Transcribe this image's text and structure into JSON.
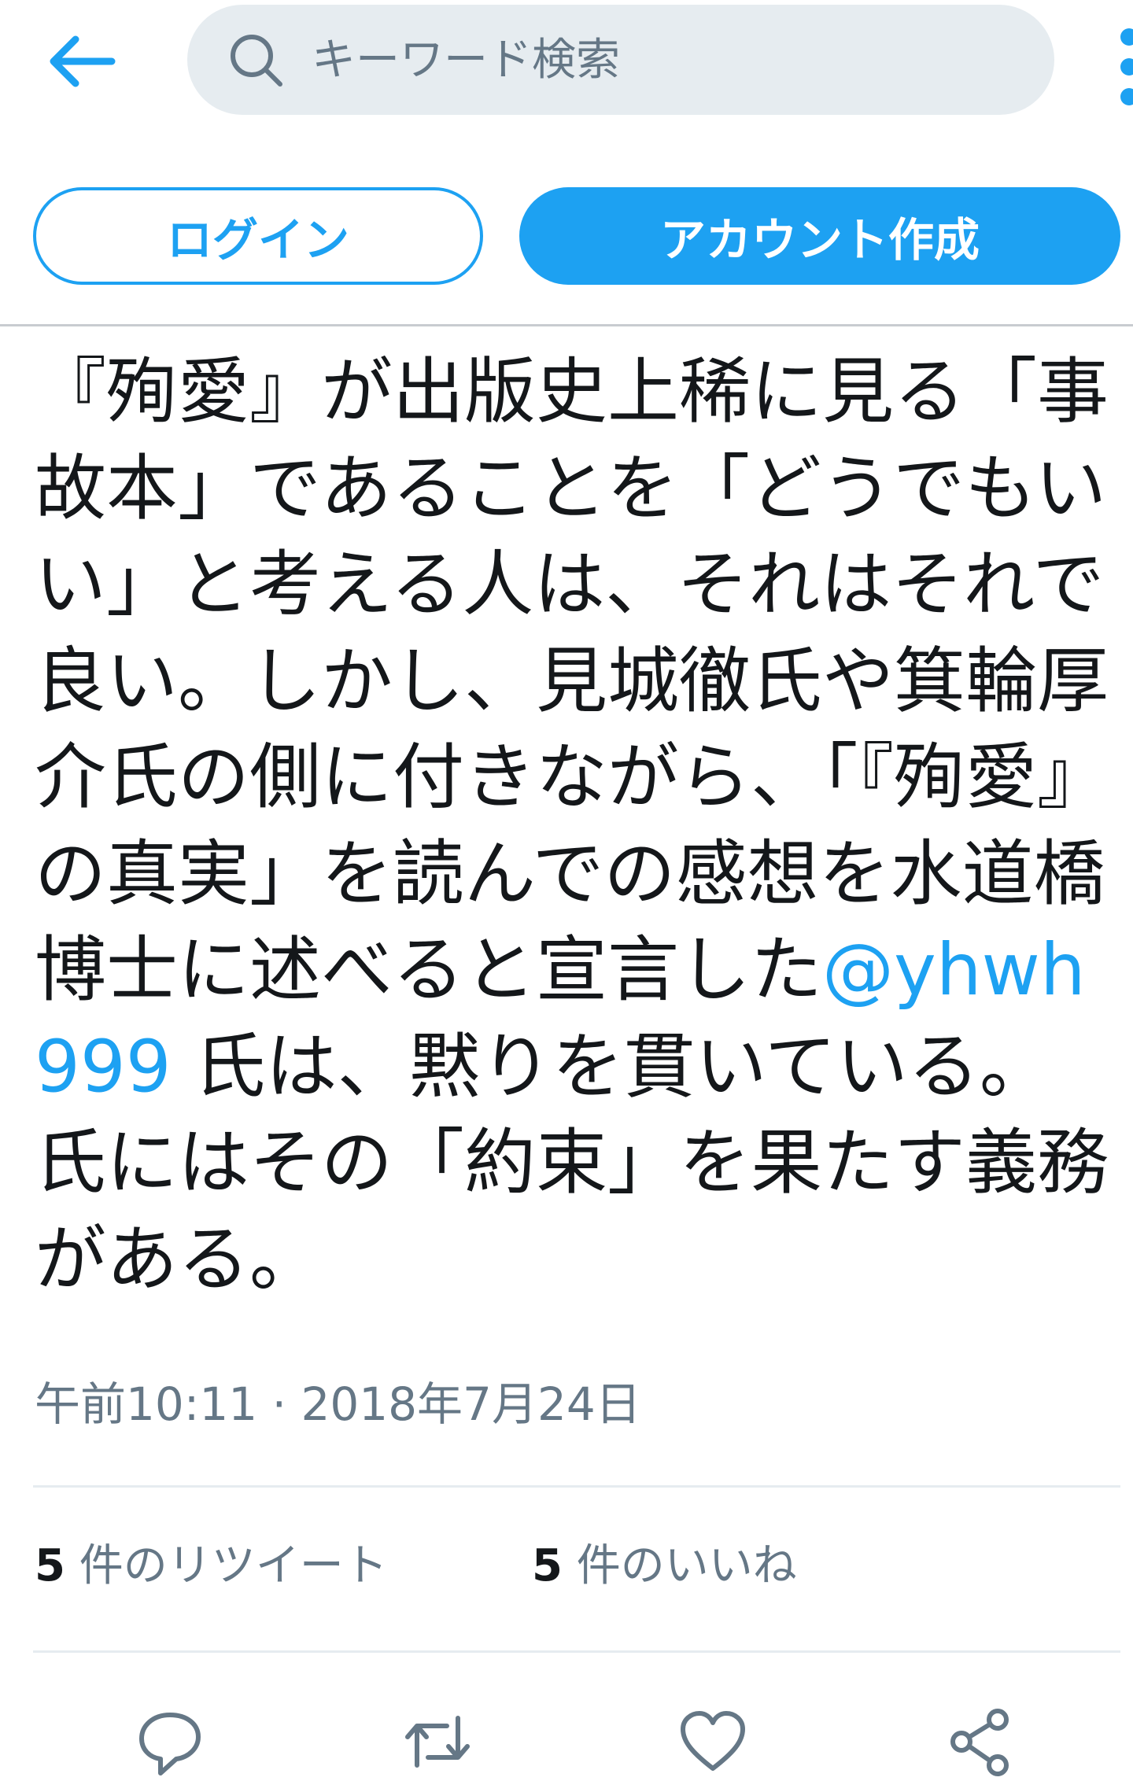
{
  "header": {
    "back_icon": "arrow-left-icon",
    "search": {
      "placeholder": "キーワード検索",
      "value": "",
      "icon": "search-icon"
    },
    "more_icon": "vertical-dots-icon"
  },
  "auth": {
    "login_label": "ログイン",
    "signup_label": "アカウント作成"
  },
  "tweet": {
    "text_before": "『殉愛』が出版史上稀に見る「事故本」であることを「どうでもいい」と考える人は、それはそれで良い。しかし、見城徹氏や箕輪厚介氏の側に付きながら、「『殉愛』の真実」を読んでの感想を水道橋博士に述べると宣言した",
    "mention": "@yhwh999",
    "text_after": " 氏は、黙りを貫いている。氏にはその「約束」を果たす義務がある。",
    "timestamp": "午前10:11 · 2018年7月24日"
  },
  "stats": {
    "retweets": {
      "count": "5",
      "label": " 件のリツイート"
    },
    "likes": {
      "count": "5",
      "label": " 件のいいね"
    }
  },
  "actions": [
    {
      "name": "reply",
      "icon": "reply-icon"
    },
    {
      "name": "retweet",
      "icon": "retweet-icon"
    },
    {
      "name": "like",
      "icon": "heart-icon"
    },
    {
      "name": "share",
      "icon": "share-icon"
    }
  ],
  "colors": {
    "accent": "#1da1f2",
    "text": "#14171a",
    "secondary": "#657786",
    "search_bg": "#e6ecf0"
  }
}
